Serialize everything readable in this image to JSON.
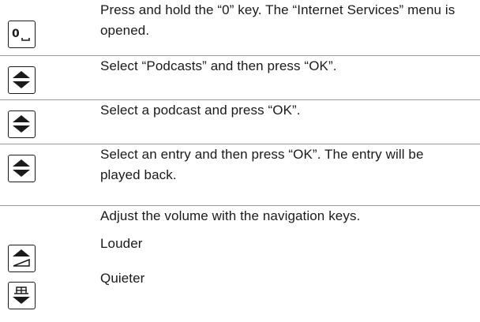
{
  "steps": [
    {
      "key": {
        "label": "0",
        "icon": "zero-space-key-icon"
      },
      "text": "Press and hold the “0” key. The “Internet Services” menu is opened."
    },
    {
      "key": {
        "icon": "up-down-navigation-key-icon"
      },
      "text": "Select “Podcasts” and then press “OK”."
    },
    {
      "key": {
        "icon": "up-down-navigation-key-icon"
      },
      "text": "Select a podcast and press “OK”."
    },
    {
      "key": {
        "icon": "up-down-navigation-key-icon"
      },
      "text": "Select an entry and then press “OK”. The entry will be played back."
    },
    {
      "text": "Adjust the volume with the navigation keys."
    },
    {
      "key": {
        "icon": "volume-up-key-icon"
      },
      "text": "Louder"
    },
    {
      "key": {
        "icon": "volume-down-key-icon"
      },
      "text": "Quieter"
    }
  ],
  "colors": {
    "text": "#1a1a1a",
    "rule": "#9a9a9a"
  }
}
